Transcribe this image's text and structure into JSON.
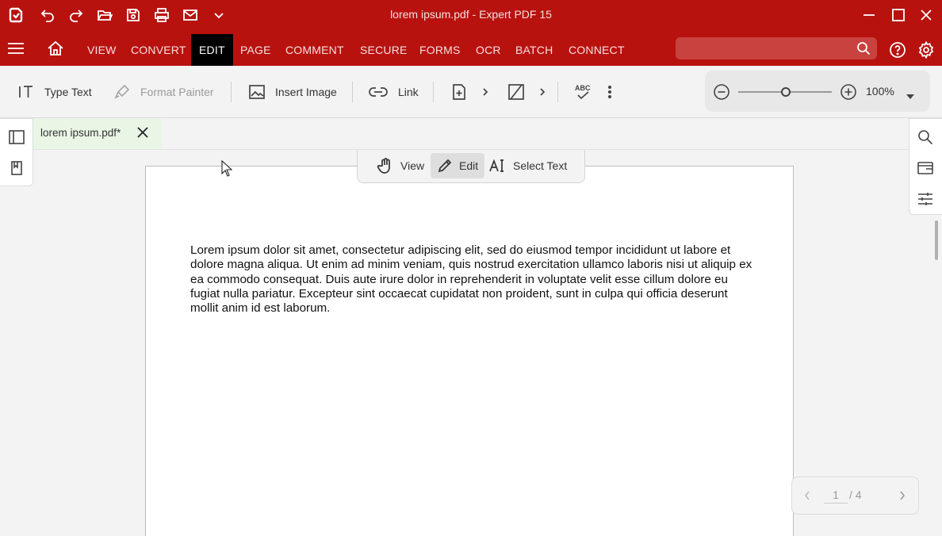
{
  "titlebar": {
    "title": "lorem ipsum.pdf   -   Expert PDF 15",
    "icons": [
      "app-logo-icon",
      "undo-icon",
      "redo-icon",
      "open-folder-icon",
      "save-icon",
      "print-icon",
      "email-icon",
      "customize-chevron-icon",
      "minimize-icon",
      "maximize-icon",
      "close-icon"
    ]
  },
  "menu": {
    "tabs": [
      "VIEW",
      "CONVERT",
      "EDIT",
      "PAGE",
      "COMMENT",
      "SECURE",
      "FORMS",
      "OCR",
      "BATCH",
      "CONNECT"
    ],
    "active": "EDIT",
    "search_placeholder": ""
  },
  "toolbar": {
    "type_text": "Type Text",
    "format_painter": "Format Painter",
    "insert_image": "Insert Image",
    "link": "Link",
    "zoom": "100%"
  },
  "doc_tab": {
    "name": "lorem ipsum.pdf*"
  },
  "modes": {
    "view": "View",
    "edit": "Edit",
    "select_text": "Select Text",
    "active": "Edit"
  },
  "document": {
    "text": "Lorem ipsum dolor sit amet, consectetur adipiscing elit, sed do eiusmod tempor incididunt ut labore et dolore magna aliqua. Ut enim ad minim veniam, quis nostrud exercitation ullamco laboris nisi ut aliquip ex ea commodo consequat. Duis aute irure dolor in reprehenderit in voluptate velit esse cillum dolore eu fugiat nulla pariatur. Excepteur sint occaecat cupidatat non proident, sunt in culpa qui officia deserunt mollit anim id est laborum."
  },
  "pagenav": {
    "current": "1",
    "total": "/ 4"
  },
  "colors": {
    "brand": "#b8120f",
    "active_tab": "#000000",
    "doc_tab_bg": "#e9f6e6"
  }
}
